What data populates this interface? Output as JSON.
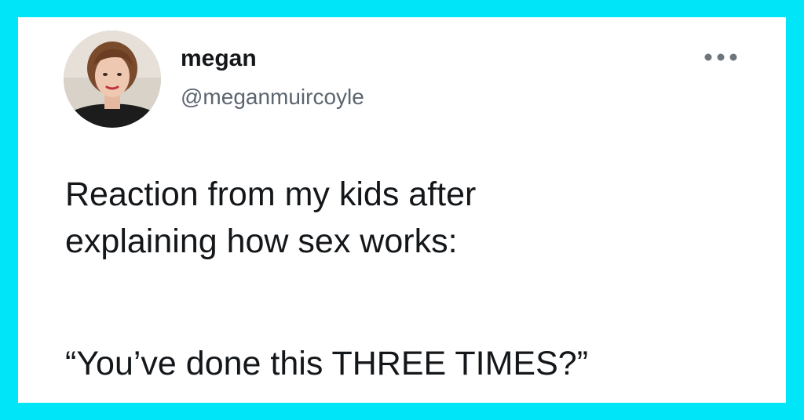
{
  "tweet": {
    "author": {
      "display_name": "megan",
      "handle": "@meganmuircoyle",
      "avatar_icon": "avatar-photo"
    },
    "more_icon": "more-horizontal-icon",
    "text_lines": [
      "Reaction from my kids after",
      "explaining how sex works:"
    ],
    "quote": "“You’ve done this THREE TIMES?”"
  },
  "colors": {
    "frame": "#00e5f7",
    "card": "#ffffff",
    "text": "#14171a",
    "handle": "#5b6570"
  }
}
